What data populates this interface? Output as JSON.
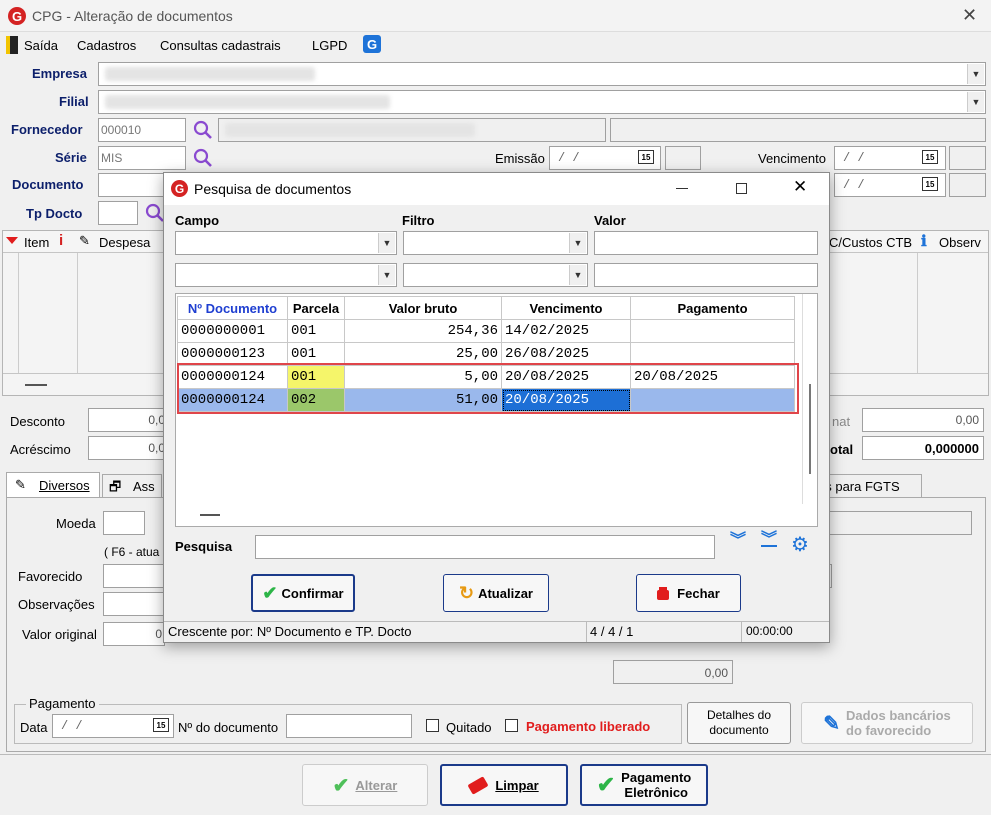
{
  "window": {
    "title": "CPG - Alteração de documentos"
  },
  "menu": [
    "Saída",
    "Cadastros",
    "Consultas cadastrais",
    "LGPD"
  ],
  "form": {
    "empresa_label": "Empresa",
    "filial_label": "Filial",
    "fornecedor_label": "Fornecedor",
    "fornecedor_value": "000010",
    "serie_label": "Série",
    "serie_value": "MIS",
    "emissao_label": "Emissão",
    "emissao_value": "/ /",
    "vencimento_label": "Vencimento",
    "vencimento_value": "/ /",
    "vencimento2_value": "/ /",
    "documento_label": "Documento",
    "tp_docto_label": "Tp Docto"
  },
  "grid": {
    "item": "Item",
    "despesa": "Despesa",
    "cc": "C/Custos CTB",
    "observ": "Observ"
  },
  "totals": {
    "desconto_label": "Desconto",
    "desconto_value": "0,0",
    "acrescimo_label": "Acréscimo",
    "acrescimo_value": "0,0",
    "right1_label": "nat",
    "right1_value": "0,00",
    "total_label": "otal",
    "total_value": "0,000000",
    "mid_value": "0,00"
  },
  "tabs": {
    "diversos": "Diversos",
    "ass": "Ass",
    "fgts": "os para FGTS"
  },
  "diversos": {
    "moeda_label": "Moeda",
    "f6": "( F6 - atua",
    "favorecido_label": "Favorecido",
    "obs_label": "Observações",
    "valor_label": "Valor original",
    "valor_value": "0"
  },
  "pagamento": {
    "legend": "Pagamento",
    "data_label": "Data",
    "data_value": "/ /",
    "ndoc_label": "Nº do documento",
    "quitado": "Quitado",
    "liberado": "Pagamento liberado",
    "detalhes_1": "Detalhes do",
    "detalhes_2": "documento",
    "dados_1": "Dados bancários",
    "dados_2": "do favorecido"
  },
  "bottom": {
    "alterar": "Alterar",
    "limpar": "Limpar",
    "pagamento_1": "Pagamento",
    "pagamento_2": "Eletrônico"
  },
  "dialog": {
    "title": "Pesquisa de documentos",
    "campo": "Campo",
    "filtro": "Filtro",
    "valor": "Valor",
    "columns": [
      "Nº Documento",
      "Parcela",
      "Valor bruto",
      "Vencimento",
      "Pagamento"
    ],
    "rows": [
      {
        "doc": "0000000001",
        "parcela": "001",
        "valor": "254,36",
        "venc": "14/02/2025",
        "pag": ""
      },
      {
        "doc": "0000000123",
        "parcela": "001",
        "valor": "25,00",
        "venc": "26/08/2025",
        "pag": ""
      },
      {
        "doc": "0000000124",
        "parcela": "001",
        "valor": "5,00",
        "venc": "20/08/2025",
        "pag": "20/08/2025"
      },
      {
        "doc": "0000000124",
        "parcela": "002",
        "valor": "51,00",
        "venc": "20/08/2025",
        "pag": ""
      }
    ],
    "pesquisa_label": "Pesquisa",
    "confirmar": "Confirmar",
    "atualizar": "Atualizar",
    "fechar": "Fechar",
    "status": "Crescente por: Nº Documento e TP. Docto",
    "status_count": "4 / 4 / 1",
    "status_time": "00:00:00"
  },
  "colors": {
    "label_blue": "#0c1f6b",
    "selected_row": "#9ab8ec",
    "highlight_yellow": "#f5f56a",
    "highlight_green": "#9bc76a",
    "red": "#e11d1d",
    "accent": "#1e73d8"
  }
}
